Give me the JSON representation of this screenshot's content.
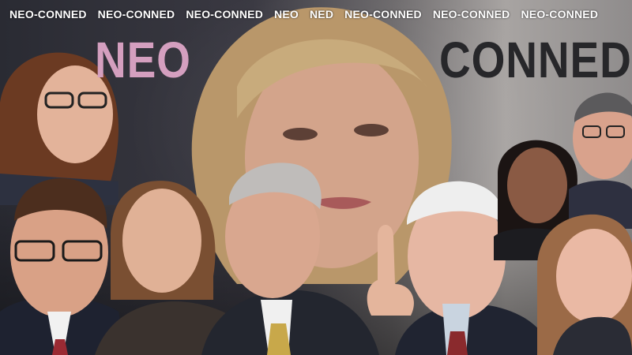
{
  "image": {
    "band_texts": [
      "NEO-CONNED",
      "NEO-CONNED",
      "NEO-CONNED",
      "NEO",
      "NED",
      "NEO-CONNED",
      "NEO-CONNED",
      "NEO-CONNED"
    ],
    "headline_left": "NEO",
    "headline_right": "CONNED",
    "colors": {
      "headline_left": "#d49fbf",
      "headline_right": "#27272a",
      "band_text": "#ffffff"
    }
  }
}
